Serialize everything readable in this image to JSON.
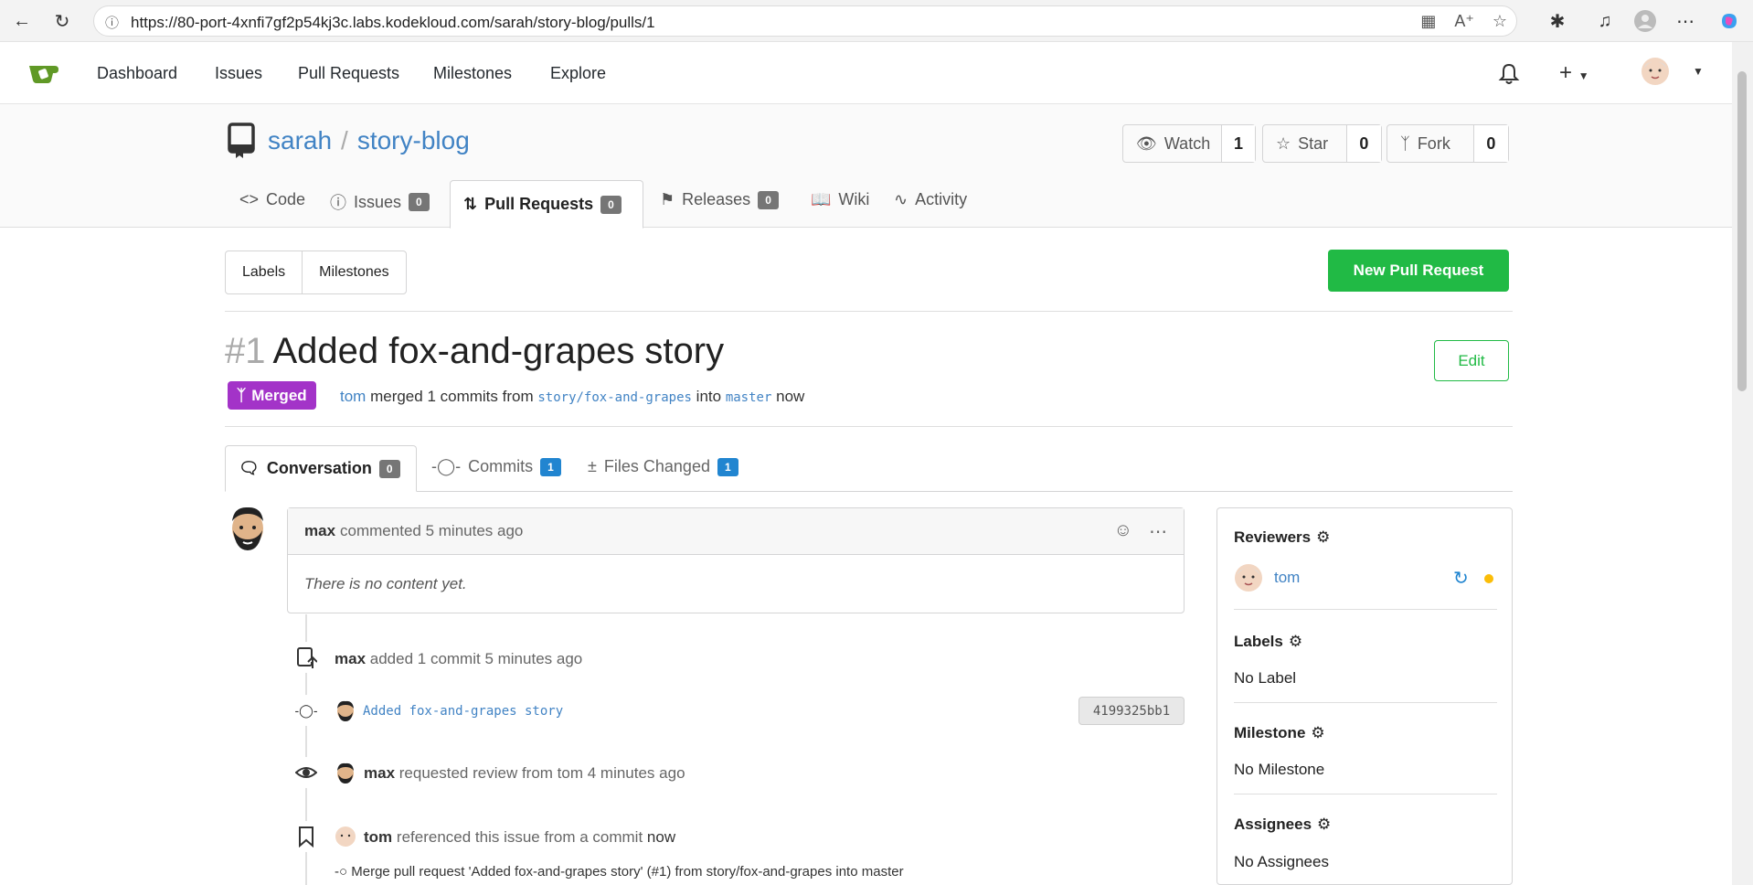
{
  "browser": {
    "url": "https://80-port-4xnfi7gf2p54kj3c.labs.kodekloud.com/sarah/story-blog/pulls/1"
  },
  "nav": {
    "items": [
      "Dashboard",
      "Issues",
      "Pull Requests",
      "Milestones",
      "Explore"
    ]
  },
  "repo": {
    "owner": "sarah",
    "separator": "/",
    "name": "story-blog",
    "watch_label": "Watch",
    "watch_count": "1",
    "star_label": "Star",
    "star_count": "0",
    "fork_label": "Fork",
    "fork_count": "0",
    "tabs": [
      {
        "label": "Code"
      },
      {
        "label": "Issues",
        "count": "0"
      },
      {
        "label": "Pull Requests",
        "count": "0"
      },
      {
        "label": "Releases",
        "count": "0"
      },
      {
        "label": "Wiki"
      },
      {
        "label": "Activity"
      }
    ]
  },
  "filters": {
    "labels": "Labels",
    "milestones": "Milestones",
    "new_pr": "New Pull Request"
  },
  "pr": {
    "number": "#1",
    "title": "Added fox-and-grapes story",
    "edit_label": "Edit",
    "status": "Merged",
    "merger": "tom",
    "merged_text": "merged 1 commits from",
    "head_branch": "story/fox-and-grapes",
    "into_text": "into",
    "base_branch": "master",
    "time": "now",
    "tabs": [
      {
        "label": "Conversation",
        "count": "0"
      },
      {
        "label": "Commits",
        "count": "1"
      },
      {
        "label": "Files Changed",
        "count": "1"
      }
    ]
  },
  "timeline": {
    "comment": {
      "author": "max",
      "action": "commented 5 minutes ago",
      "body": "There is no content yet."
    },
    "commit_event": {
      "author": "max",
      "text": "added 1 commit 5 minutes ago"
    },
    "commit": {
      "message": "Added fox-and-grapes story",
      "sha": "4199325bb1"
    },
    "review_event": {
      "author": "max",
      "text": "requested review from tom 4 minutes ago"
    },
    "reference_event": {
      "author": "tom",
      "text": "referenced this issue from a commit",
      "time": "now"
    },
    "reference_commit": "Merge pull request 'Added fox-and-grapes story' (#1) from story/fox-and-grapes into master"
  },
  "sidebar": {
    "reviewers_label": "Reviewers",
    "reviewer_name": "tom",
    "labels_label": "Labels",
    "labels_value": "No Label",
    "milestone_label": "Milestone",
    "milestone_value": "No Milestone",
    "assignees_label": "Assignees",
    "assignees_value": "No Assignees"
  },
  "colors": {
    "merged": "#a333c8",
    "green": "#21ba45",
    "link": "#4183c4",
    "pending_dot": "#fbbd08"
  }
}
